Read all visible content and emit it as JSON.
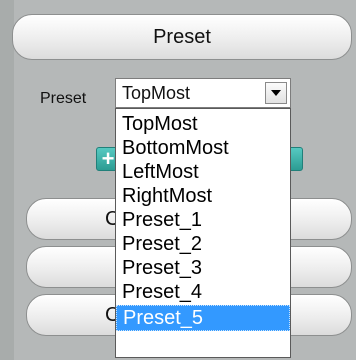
{
  "header": {
    "preset_button_label": "Preset"
  },
  "preset_field": {
    "label": "Preset",
    "selected_value": "TopMost"
  },
  "dropdown": {
    "options": [
      {
        "label": "TopMost"
      },
      {
        "label": "BottomMost"
      },
      {
        "label": "LeftMost"
      },
      {
        "label": "RightMost"
      },
      {
        "label": "Preset_1"
      },
      {
        "label": "Preset_2"
      },
      {
        "label": "Preset_3"
      },
      {
        "label": "Preset_4"
      },
      {
        "label": "Preset_5"
      }
    ],
    "highlighted_option": "Preset_5"
  },
  "buttons_below": [
    {
      "partial_label": "C"
    },
    {
      "partial_label": ""
    },
    {
      "partial_label": "C"
    }
  ],
  "icons": {
    "add": "plus-icon",
    "dropdown_arrow": "triangle-down-icon"
  },
  "colors": {
    "background": "#b5b8b8",
    "accent_button": "#2c9c93",
    "selection": "#3399ff"
  }
}
